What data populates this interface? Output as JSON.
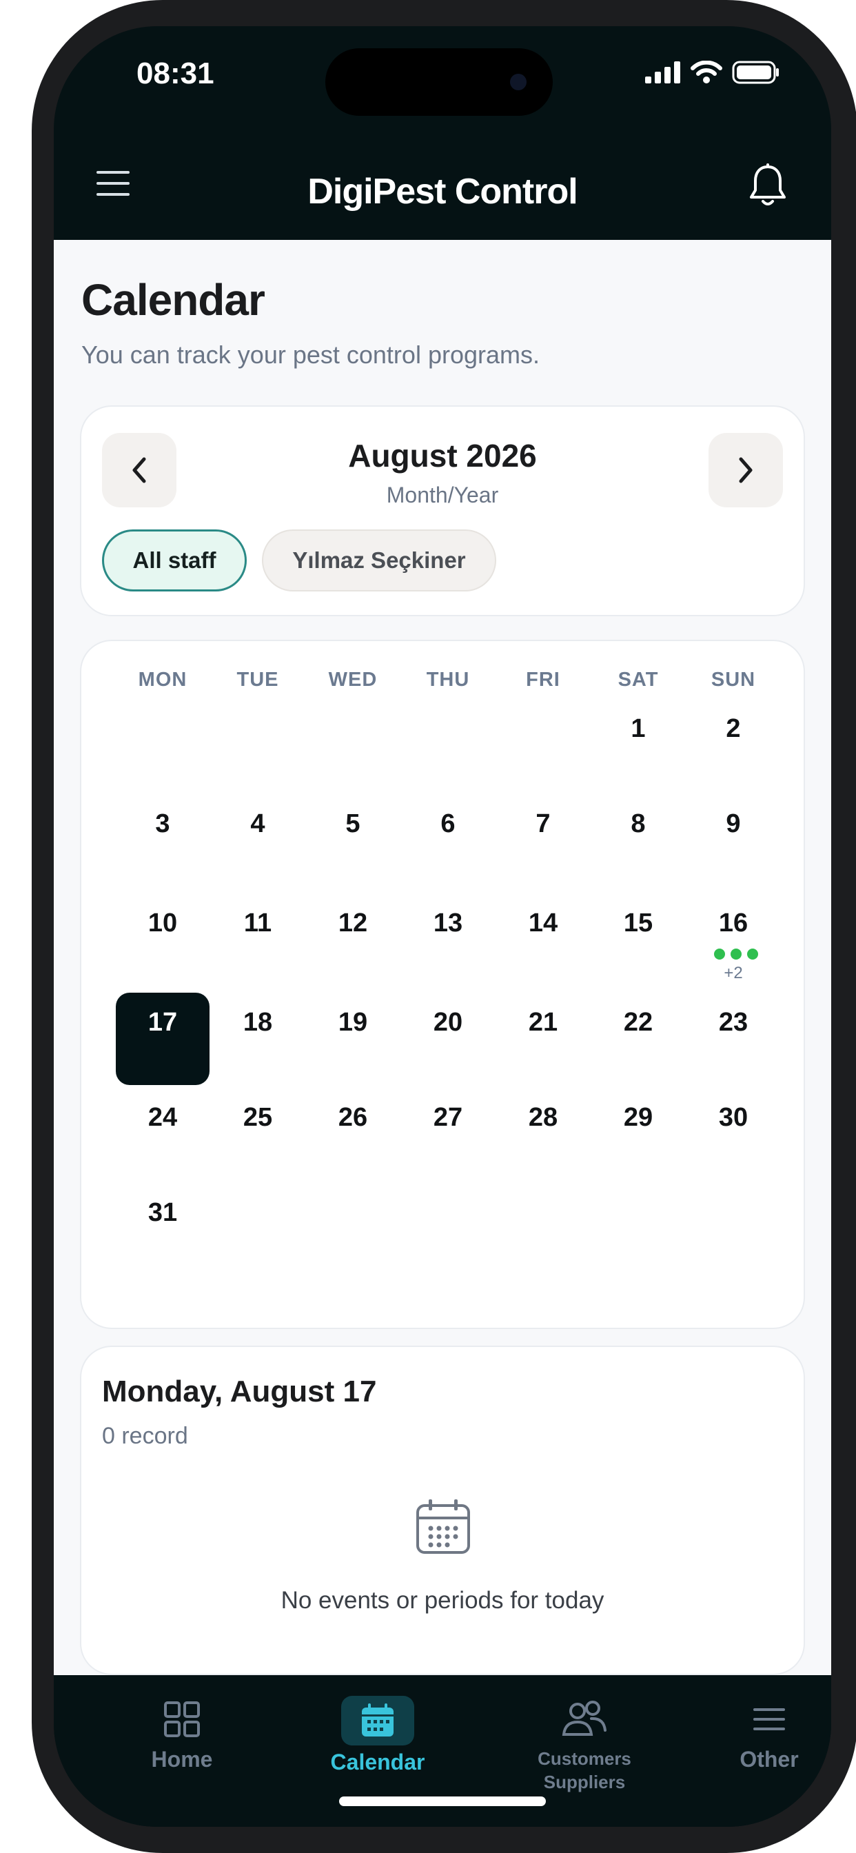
{
  "status_bar": {
    "time": "08:31"
  },
  "header": {
    "title": "DigiPest Control",
    "menu_icon": "hamburger-icon",
    "notification_icon": "bell-icon"
  },
  "page": {
    "title": "Calendar",
    "subtitle": "You can track your pest control programs."
  },
  "month_picker": {
    "label": "August 2026",
    "sublabel": "Month/Year",
    "filters": [
      {
        "label": "All staff",
        "selected": true
      },
      {
        "label": "Yılmaz Seçkiner",
        "selected": false
      }
    ]
  },
  "calendar": {
    "weekdays": [
      "MON",
      "TUE",
      "WED",
      "THU",
      "FRI",
      "SAT",
      "SUN"
    ],
    "days": [
      "1",
      "2",
      "3",
      "4",
      "5",
      "6",
      "7",
      "8",
      "9",
      "10",
      "11",
      "12",
      "13",
      "14",
      "15",
      "16",
      "17",
      "18",
      "19",
      "20",
      "21",
      "22",
      "23",
      "24",
      "25",
      "26",
      "27",
      "28",
      "29",
      "30",
      "31"
    ],
    "selected_day": "17",
    "event_day": "16",
    "event_more": "+2",
    "event_color": "#2fbf4f"
  },
  "day_detail": {
    "title": "Monday, August 17",
    "count": "0 record",
    "empty_text": "No events or periods for today",
    "empty_icon": "calendar-icon"
  },
  "tabbar": {
    "tabs": [
      {
        "label": "Home",
        "icon": "grid-icon",
        "active": false
      },
      {
        "label": "Calendar",
        "icon": "calendar-icon",
        "active": true
      },
      {
        "label_line1": "Customers",
        "label_line2": "Suppliers",
        "icon": "people-icon",
        "active": false
      },
      {
        "label": "Other",
        "icon": "menu-icon",
        "active": false
      }
    ],
    "active_color": "#39c4dc"
  }
}
